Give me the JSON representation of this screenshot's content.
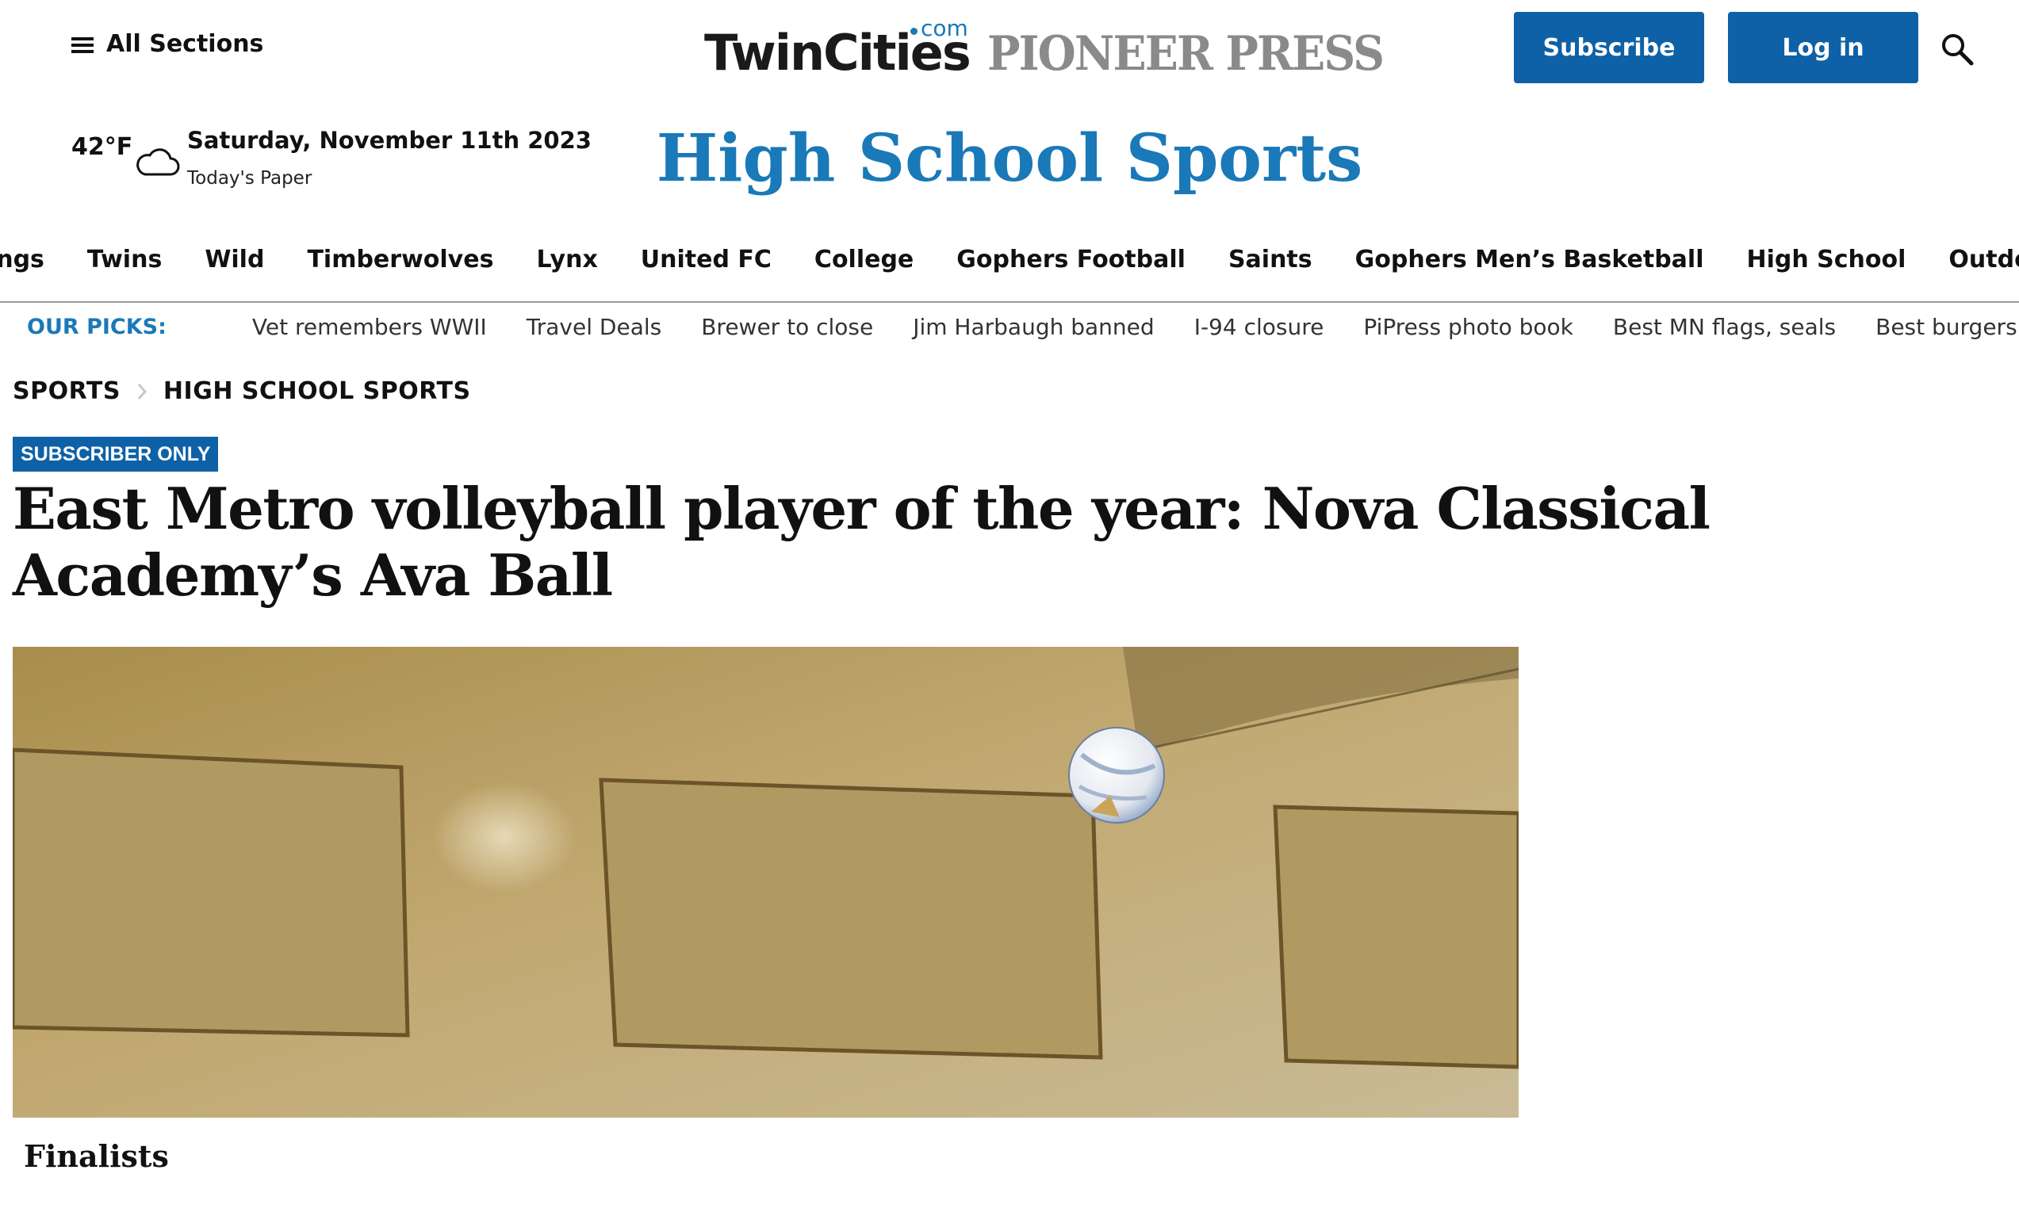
{
  "header": {
    "all_sections_label": "All Sections",
    "logo": {
      "twincities": "TwinCities",
      "com": "com",
      "pioneer_press": "PIONEER PRESS"
    },
    "subscribe_label": "Subscribe",
    "login_label": "Log in",
    "icons": {
      "menu": "hamburger-menu-icon",
      "search": "search-icon",
      "weather": "cloud-icon"
    }
  },
  "weather": {
    "temperature": "42°F",
    "condition": "cloudy"
  },
  "date": {
    "text": "Saturday, November 11th 2023",
    "todays_paper": "Today's Paper"
  },
  "section_title": "High School Sports",
  "nav": {
    "items": [
      "Vikings",
      "Twins",
      "Wild",
      "Timberwolves",
      "Lynx",
      "United FC",
      "College",
      "Gophers Football",
      "Saints",
      "Gophers Men’s Basketball",
      "High School",
      "Outdoors"
    ]
  },
  "picks": {
    "label": "OUR PICKS:",
    "items": [
      "Vet remembers WWII",
      "Travel Deals",
      "Brewer to close",
      "Jim Harbaugh banned",
      "I-94 closure",
      "PiPress photo book",
      "Best MN flags, seals",
      "Best burgers"
    ]
  },
  "breadcrumb": {
    "items": [
      "SPORTS",
      "HIGH SCHOOL SPORTS"
    ]
  },
  "article": {
    "badge": "SUBSCRIBER ONLY",
    "headline": "East Metro volleyball player of the year: Nova Classical Academy’s Ava Ball",
    "caption": "Finalists"
  },
  "colors": {
    "brand_blue": "#1a79b8",
    "button_blue": "#0e61a6",
    "logo_gray": "#8a8a8a"
  }
}
